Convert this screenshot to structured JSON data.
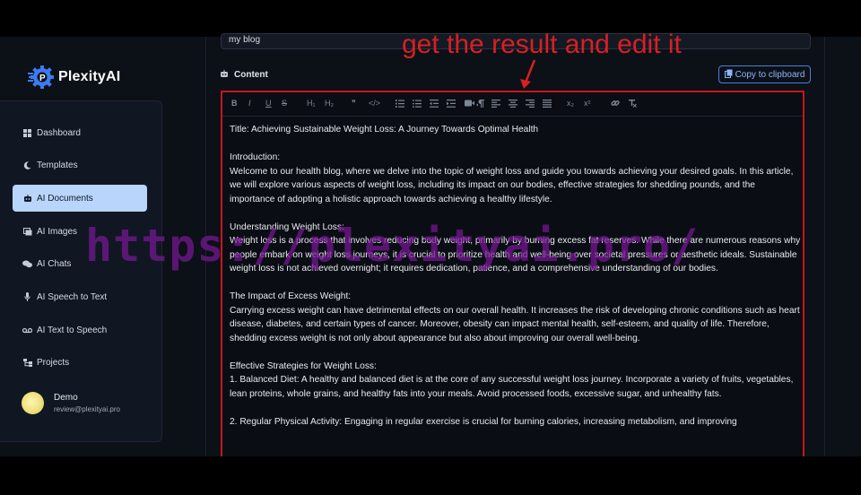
{
  "app": {
    "name": "PlexityAI"
  },
  "sidebar": {
    "items": [
      {
        "label": "Dashboard",
        "icon": "grid-icon",
        "active": false
      },
      {
        "label": "Templates",
        "icon": "moon-icon",
        "active": false
      },
      {
        "label": "AI Documents",
        "icon": "robot-icon",
        "active": true
      },
      {
        "label": "AI Images",
        "icon": "images-icon",
        "active": false
      },
      {
        "label": "AI Chats",
        "icon": "chat-icon",
        "active": false
      },
      {
        "label": "AI Speech to Text",
        "icon": "microphone-icon",
        "active": false
      },
      {
        "label": "AI Text to Speech",
        "icon": "voicemail-icon",
        "active": false
      },
      {
        "label": "Projects",
        "icon": "sitemap-icon",
        "active": false
      }
    ],
    "user": {
      "name": "Demo",
      "email": "review@plexityai.pro"
    }
  },
  "form": {
    "title_value": "my blog",
    "content_label": "Content",
    "copy_button_label": "Copy to clipboard"
  },
  "toolbar": {
    "buttons": [
      "B",
      "I",
      "U",
      "S",
      "H₁",
      "H₂",
      "❞",
      "</>",
      "ordered-list",
      "bullet-list",
      "outdent",
      "indent",
      "video",
      "rtl",
      "align-left",
      "align-center",
      "align-right",
      "justify",
      "x₂",
      "x²",
      "link",
      "clear-format"
    ]
  },
  "editor": {
    "title": "Title: Achieving Sustainable Weight Loss: A Journey Towards Optimal Health",
    "intro_heading": "Introduction:",
    "intro_body": "Welcome to our health blog, where we delve into the topic of weight loss and guide you towards achieving your desired goals. In this article, we will explore various aspects of weight loss, including its impact on our bodies, effective strategies for shedding pounds, and the importance of adopting a holistic approach towards achieving a healthy lifestyle.",
    "understanding_heading": "Understanding Weight Loss:",
    "understanding_body": "Weight loss is a process that involves reducing body weight, primarily by burning excess fat reserves. While there are numerous reasons why people embark on weight loss journeys, it is crucial to prioritize health and well-being over societal pressures or aesthetic ideals. Sustainable weight loss is not achieved overnight; it requires dedication, patience, and a comprehensive understanding of our bodies.",
    "impact_heading": "The Impact of Excess Weight:",
    "impact_body": "Carrying excess weight can have detrimental effects on our overall health. It increases the risk of developing chronic conditions such as heart disease, diabetes, and certain types of cancer. Moreover, obesity can impact mental health, self-esteem, and quality of life. Therefore, shedding excess weight is not only about appearance but also about improving our overall well-being.",
    "strategies_heading": "Effective Strategies for Weight Loss:",
    "strategy_1": "1. Balanced Diet: A healthy and balanced diet is at the core of any successful weight loss journey. Incorporate a variety of fruits, vegetables, lean proteins, whole grains, and healthy fats into your meals. Avoid processed foods, excessive sugar, and unhealthy fats.",
    "strategy_2": "2. Regular Physical Activity: Engaging in regular exercise is crucial for burning calories, increasing metabolism, and improving"
  },
  "overlay": {
    "annotation": "get the result and edit it",
    "watermark": "https://plexityai.pro/",
    "annotation_color": "#d81f24",
    "watermark_color": "#7a1896"
  },
  "colors": {
    "accent": "#4b7fd8",
    "active_nav": "#b9d5fb",
    "highlight_border": "#c8161c"
  }
}
